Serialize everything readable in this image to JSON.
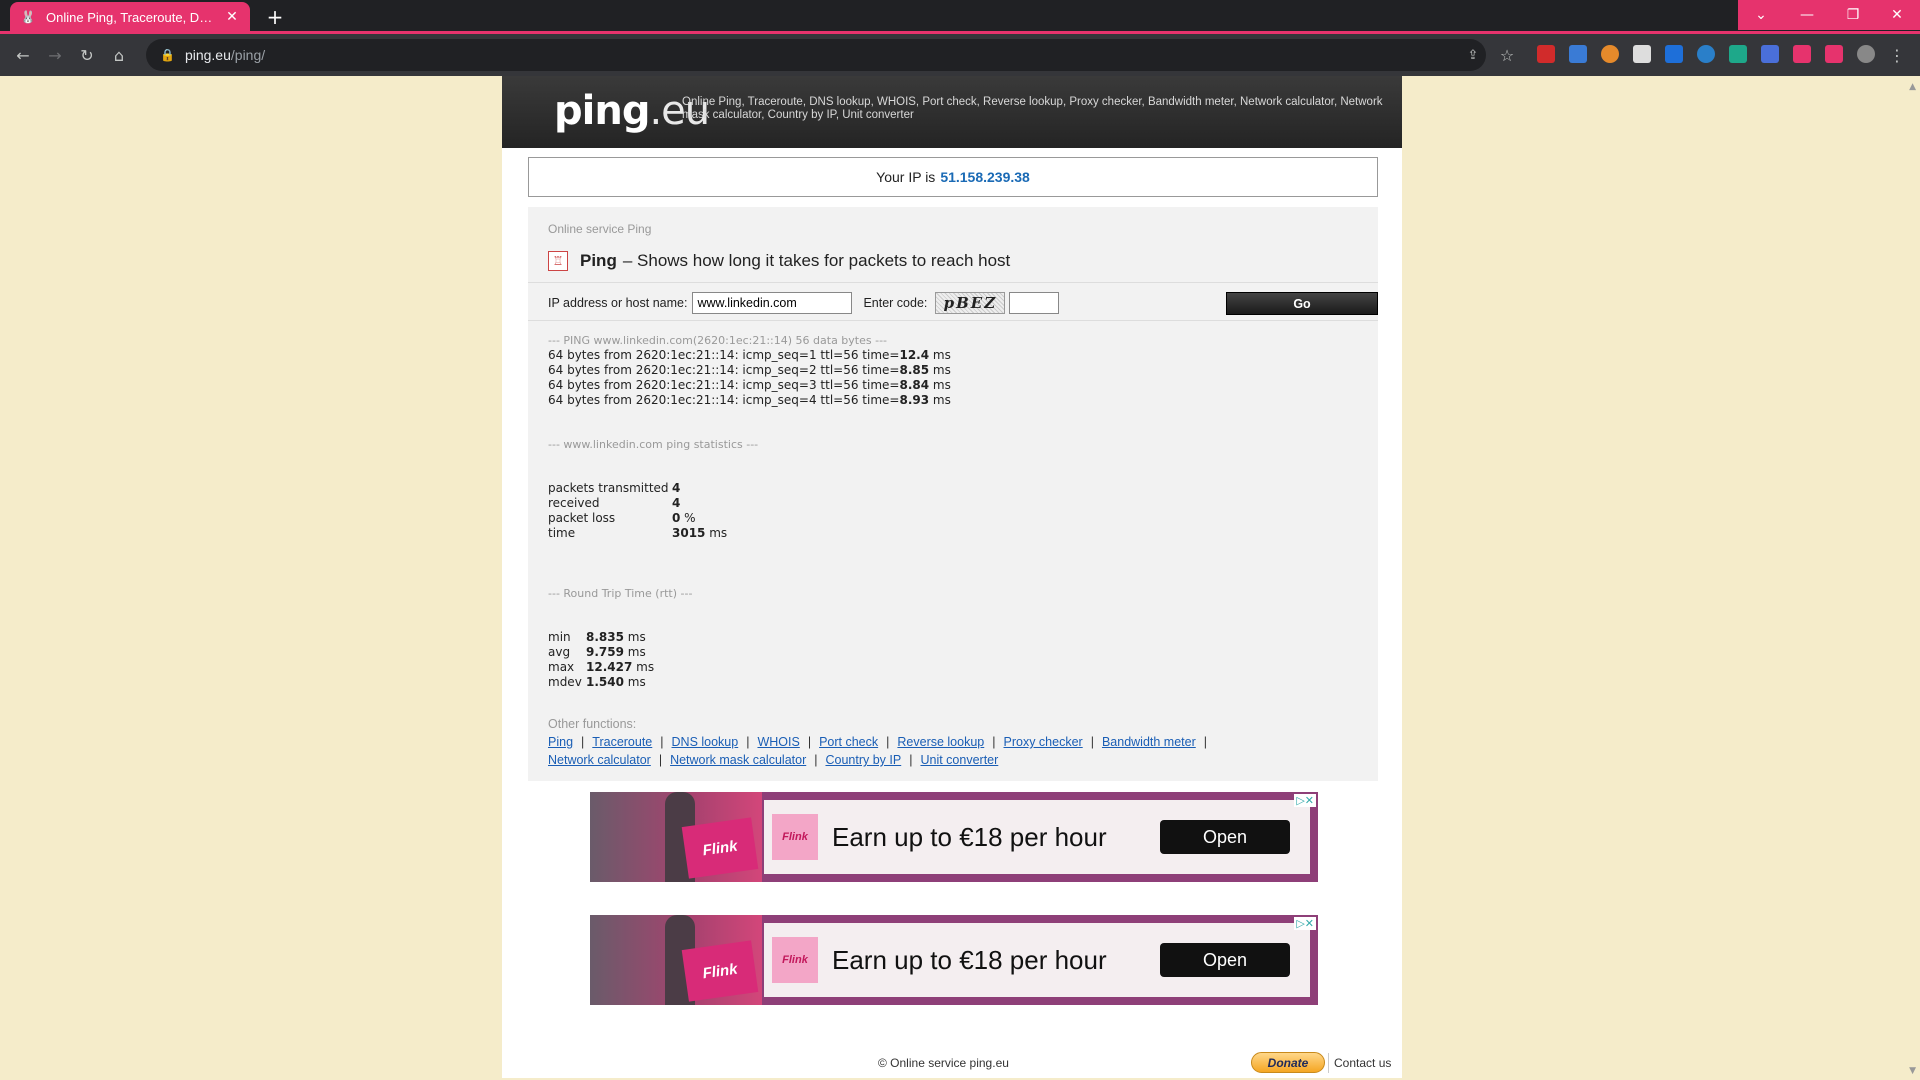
{
  "browser": {
    "tab_title": "Online Ping, Traceroute, DNS lookup, WHOIS",
    "tab_close": "✕",
    "new_tab": "+",
    "url_host": "ping.eu",
    "url_path": "/ping/",
    "accent": "#e6336d"
  },
  "header": {
    "logo_main": "ping",
    "logo_suffix": ".eu",
    "tagline": "Online Ping, Traceroute, DNS lookup, WHOIS, Port check, Reverse lookup, Proxy checker, Bandwidth meter, Network calculator, Network mask calculator, Country by IP, Unit converter"
  },
  "ip": {
    "label": "Your IP is",
    "value": "51.158.239.38"
  },
  "service": {
    "crumb": "Online service Ping",
    "title": "Ping",
    "description": "– Shows how long it takes for packets to reach host"
  },
  "form": {
    "host_label": "IP address or host name:",
    "host_value": "www.linkedin.com",
    "code_label": "Enter code:",
    "captcha_text": "pBEZ",
    "code_value": "",
    "go_label": "Go"
  },
  "result": {
    "header": "--- PING www.linkedin.com(2620:1ec:21::14) 56 data bytes ---",
    "lines": [
      {
        "prefix": "64 bytes from 2620:1ec:21::14: icmp_seq=1 ttl=56 time=",
        "time": "12.4",
        "unit": " ms"
      },
      {
        "prefix": "64 bytes from 2620:1ec:21::14: icmp_seq=2 ttl=56 time=",
        "time": "8.85",
        "unit": " ms"
      },
      {
        "prefix": "64 bytes from 2620:1ec:21::14: icmp_seq=3 ttl=56 time=",
        "time": "8.84",
        "unit": " ms"
      },
      {
        "prefix": "64 bytes from 2620:1ec:21::14: icmp_seq=4 ttl=56 time=",
        "time": "8.93",
        "unit": " ms"
      }
    ],
    "stats_header": "--- www.linkedin.com ping statistics ---",
    "stats": [
      {
        "key": "packets transmitted",
        "value": "4",
        "unit": ""
      },
      {
        "key": "received",
        "value": "4",
        "unit": ""
      },
      {
        "key": "packet loss",
        "value": "0",
        "unit": " %"
      },
      {
        "key": "time",
        "value": "3015",
        "unit": " ms"
      }
    ],
    "rtt_header": "--- Round Trip Time (rtt) ---",
    "rtt": [
      {
        "key": "min",
        "value": "8.835",
        "unit": " ms"
      },
      {
        "key": "avg",
        "value": "9.759",
        "unit": " ms"
      },
      {
        "key": "max",
        "value": "12.427",
        "unit": " ms"
      },
      {
        "key": "mdev",
        "value": "1.540",
        "unit": " ms"
      }
    ]
  },
  "other": {
    "label": "Other functions:",
    "links": [
      "Ping",
      "Traceroute",
      "DNS lookup",
      "WHOIS",
      "Port check",
      "Reverse lookup",
      "Proxy checker",
      "Bandwidth meter",
      "Network calculator",
      "Network mask calculator",
      "Country by IP",
      "Unit converter"
    ],
    "separator": "|"
  },
  "ads": [
    {
      "brand": "Flink",
      "headline": "Earn up to €18 per hour",
      "cta": "Open",
      "adchoices": "▷✕"
    },
    {
      "brand": "Flink",
      "headline": "Earn up to €18 per hour",
      "cta": "Open",
      "adchoices": "▷✕"
    }
  ],
  "footer": {
    "copyright": "© Online service ping.eu",
    "donate": "Donate",
    "contact": "Contact us"
  }
}
